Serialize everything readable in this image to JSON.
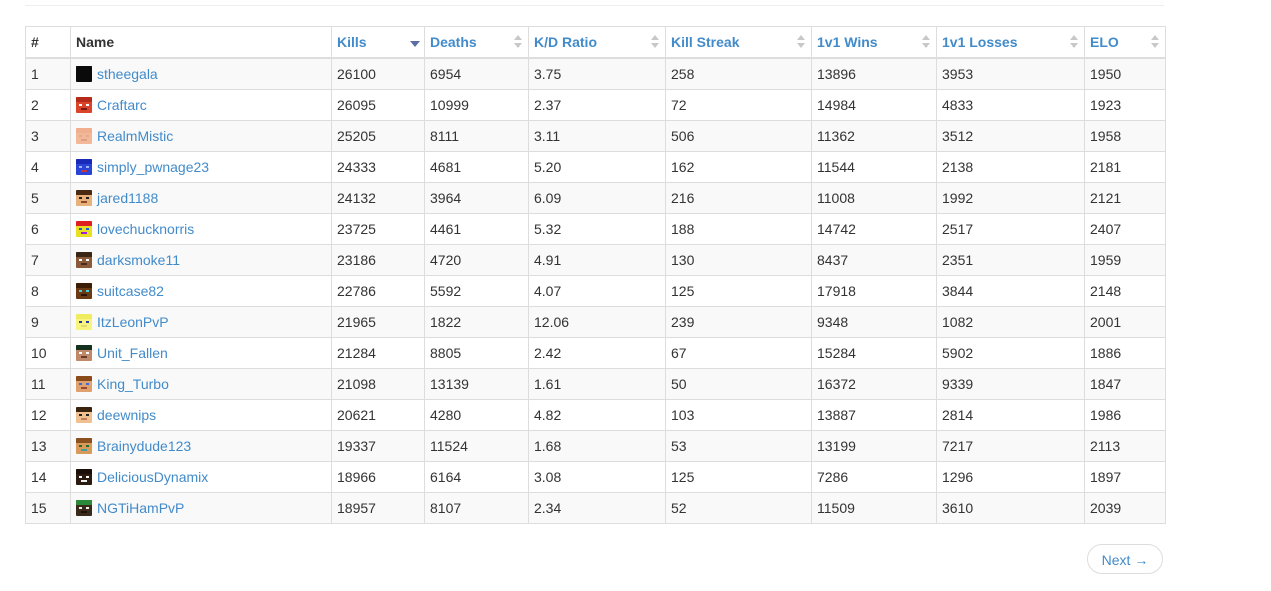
{
  "table": {
    "headers": [
      {
        "label": "#",
        "sortable": false
      },
      {
        "label": "Name",
        "sortable": false
      },
      {
        "label": "Kills",
        "sortable": true,
        "sort": "desc"
      },
      {
        "label": "Deaths",
        "sortable": true
      },
      {
        "label": "K/D Ratio",
        "sortable": true
      },
      {
        "label": "Kill Streak",
        "sortable": true
      },
      {
        "label": "1v1 Wins",
        "sortable": true
      },
      {
        "label": "1v1 Losses",
        "sortable": true
      },
      {
        "label": "ELO",
        "sortable": true
      }
    ],
    "rows": [
      {
        "rank": "1",
        "name": "stheegala",
        "kills": "26100",
        "deaths": "6954",
        "kd": "3.75",
        "streak": "258",
        "wins": "13896",
        "losses": "3953",
        "elo": "1950",
        "avatar": {
          "base": "#0a0a0a",
          "hair": "#0a0a0a",
          "eyes": "#0a0a0a",
          "mouth": "#0a0a0a"
        }
      },
      {
        "rank": "2",
        "name": "Craftarc",
        "kills": "26095",
        "deaths": "10999",
        "kd": "2.37",
        "streak": "72",
        "wins": "14984",
        "losses": "4833",
        "elo": "1923",
        "avatar": {
          "base": "#d9442b",
          "hair": "#b52a1a",
          "eyes": "#ffffff",
          "mouth": "#7a1a10"
        }
      },
      {
        "rank": "3",
        "name": "RealmMistic",
        "kills": "25205",
        "deaths": "8111",
        "kd": "3.11",
        "streak": "506",
        "wins": "11362",
        "losses": "3512",
        "elo": "1958",
        "avatar": {
          "base": "#f2b89a",
          "hair": "#f0b090",
          "eyes": "#e8a888",
          "mouth": "#e0a080"
        }
      },
      {
        "rank": "4",
        "name": "simply_pwnage23",
        "kills": "24333",
        "deaths": "4681",
        "kd": "5.20",
        "streak": "162",
        "wins": "11544",
        "losses": "2138",
        "elo": "2181",
        "avatar": {
          "base": "#2a44d8",
          "hair": "#1a2ab8",
          "eyes": "#9fb4ff",
          "mouth": "#c8343c"
        }
      },
      {
        "rank": "5",
        "name": "jared1188",
        "kills": "24132",
        "deaths": "3964",
        "kd": "6.09",
        "streak": "216",
        "wins": "11008",
        "losses": "1992",
        "elo": "2121",
        "avatar": {
          "base": "#e8b07a",
          "hair": "#4a2a10",
          "eyes": "#222222",
          "mouth": "#8a4a2a"
        }
      },
      {
        "rank": "6",
        "name": "lovechucknorris",
        "kills": "23725",
        "deaths": "4461",
        "kd": "5.32",
        "streak": "188",
        "wins": "14742",
        "losses": "2517",
        "elo": "2407",
        "avatar": {
          "base": "#e8e020",
          "hair": "#e02020",
          "eyes": "#2060e0",
          "mouth": "#a020e0"
        }
      },
      {
        "rank": "7",
        "name": "darksmoke11",
        "kills": "23186",
        "deaths": "4720",
        "kd": "4.91",
        "streak": "130",
        "wins": "8437",
        "losses": "2351",
        "elo": "1959",
        "avatar": {
          "base": "#8a5a3a",
          "hair": "#3a2414",
          "eyes": "#ffffff",
          "mouth": "#4a2a1a"
        }
      },
      {
        "rank": "8",
        "name": "suitcase82",
        "kills": "22786",
        "deaths": "5592",
        "kd": "4.07",
        "streak": "125",
        "wins": "17918",
        "losses": "3844",
        "elo": "2148",
        "avatar": {
          "base": "#6a3a14",
          "hair": "#3a1e08",
          "eyes": "#40d0e0",
          "mouth": "#2a1408"
        }
      },
      {
        "rank": "9",
        "name": "ItzLeonPvP",
        "kills": "21965",
        "deaths": "1822",
        "kd": "12.06",
        "streak": "239",
        "wins": "9348",
        "losses": "1082",
        "elo": "2001",
        "avatar": {
          "base": "#f8f480",
          "hair": "#f0ec60",
          "eyes": "#2a3aa0",
          "mouth": "#e0dc70"
        }
      },
      {
        "rank": "10",
        "name": "Unit_Fallen",
        "kills": "21284",
        "deaths": "8805",
        "kd": "2.42",
        "streak": "67",
        "wins": "15284",
        "losses": "5902",
        "elo": "1886",
        "avatar": {
          "base": "#c08a6a",
          "hair": "#14301e",
          "eyes": "#ffffff",
          "mouth": "#6a3a2a"
        }
      },
      {
        "rank": "11",
        "name": "King_Turbo",
        "kills": "21098",
        "deaths": "13139",
        "kd": "1.61",
        "streak": "50",
        "wins": "16372",
        "losses": "9339",
        "elo": "1847",
        "avatar": {
          "base": "#e0a070",
          "hair": "#8a4a1a",
          "eyes": "#3a6ad0",
          "mouth": "#9a4a2a"
        }
      },
      {
        "rank": "12",
        "name": "deewnips",
        "kills": "20621",
        "deaths": "4280",
        "kd": "4.82",
        "streak": "103",
        "wins": "13887",
        "losses": "2814",
        "elo": "1986",
        "avatar": {
          "base": "#f0c090",
          "hair": "#3a2410",
          "eyes": "#222222",
          "mouth": "#c08060"
        }
      },
      {
        "rank": "13",
        "name": "Brainydude123",
        "kills": "19337",
        "deaths": "11524",
        "kd": "1.68",
        "streak": "53",
        "wins": "13199",
        "losses": "7217",
        "elo": "2113",
        "avatar": {
          "base": "#d89a5a",
          "hair": "#8a5020",
          "eyes": "#2a6a2a",
          "mouth": "#40a0a0"
        }
      },
      {
        "rank": "14",
        "name": "DeliciousDynamix",
        "kills": "18966",
        "deaths": "6164",
        "kd": "3.08",
        "streak": "125",
        "wins": "7286",
        "losses": "1296",
        "elo": "1897",
        "avatar": {
          "base": "#2a1a10",
          "hair": "#1a0e08",
          "eyes": "#ffffff",
          "mouth": "#f0f0f0"
        }
      },
      {
        "rank": "15",
        "name": "NGTiHamPvP",
        "kills": "18957",
        "deaths": "8107",
        "kd": "2.34",
        "streak": "52",
        "wins": "11509",
        "losses": "3610",
        "elo": "2039",
        "avatar": {
          "base": "#3a2a1a",
          "hair": "#2a8a3a",
          "eyes": "#f0f0f0",
          "mouth": "#1a1008"
        }
      }
    ]
  },
  "pagination": {
    "next_label": "Next →"
  },
  "colors": {
    "link": "#428bca",
    "border": "#dddddd",
    "stripe": "#f9f9f9",
    "active_sort": "#5a6ea8"
  }
}
